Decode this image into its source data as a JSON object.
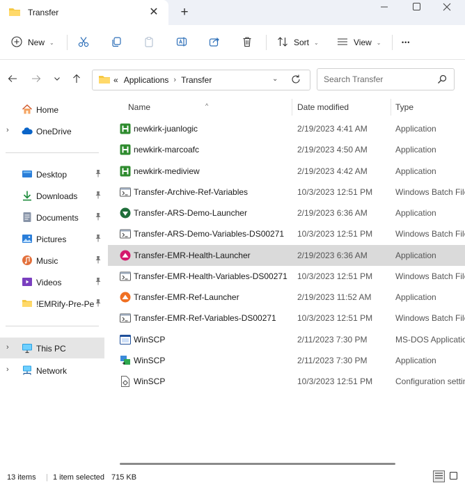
{
  "tab": {
    "title": "Transfer",
    "close_glyph": "✕",
    "new_tab_glyph": "+"
  },
  "window_controls": [
    "minimize-icon",
    "maximize-icon",
    "close-icon"
  ],
  "toolbar": {
    "new_label": "New",
    "sort_label": "Sort",
    "view_label": "View",
    "more_glyph": "•••",
    "dropdown_glyph": "⌄"
  },
  "address": {
    "overflow_glyph": "«",
    "separator_glyph": "›",
    "crumbs": [
      "Applications",
      "Transfer"
    ],
    "dropdown_glyph": "⌄"
  },
  "search": {
    "placeholder": "Search Transfer"
  },
  "sidebar": {
    "expand_glyph": "›",
    "items": [
      {
        "label": "Home",
        "icon": "home-icon"
      },
      {
        "label": "OneDrive",
        "icon": "cloud-icon"
      },
      {
        "label": "Desktop",
        "icon": "desktop-icon",
        "pinned": true
      },
      {
        "label": "Downloads",
        "icon": "download-icon",
        "pinned": true
      },
      {
        "label": "Documents",
        "icon": "document-icon",
        "pinned": true
      },
      {
        "label": "Pictures",
        "icon": "pictures-icon",
        "pinned": true
      },
      {
        "label": "Music",
        "icon": "music-icon",
        "pinned": true
      },
      {
        "label": "Videos",
        "icon": "videos-icon",
        "pinned": true
      },
      {
        "label": "!EMRify-Pre-Pen",
        "icon": "folder-icon",
        "pinned": true
      },
      {
        "label": "This PC",
        "icon": "this-pc-icon",
        "selected": true
      },
      {
        "label": "Network",
        "icon": "network-icon"
      }
    ]
  },
  "columns": {
    "name": "Name",
    "date": "Date modified",
    "type": "Type",
    "sort_glyph": "^"
  },
  "files": [
    {
      "name": "newkirk-juanlogic",
      "date": "2/19/2023 4:41 AM",
      "type": "Application",
      "icon": "h-app-icon"
    },
    {
      "name": "newkirk-marcoafc",
      "date": "2/19/2023 4:50 AM",
      "type": "Application",
      "icon": "h-app-icon"
    },
    {
      "name": "newkirk-mediview",
      "date": "2/19/2023 4:42 AM",
      "type": "Application",
      "icon": "h-app-icon"
    },
    {
      "name": "Transfer-Archive-Ref-Variables",
      "date": "10/3/2023 12:51 PM",
      "type": "Windows Batch File",
      "icon": "batch-file-icon"
    },
    {
      "name": "Transfer-ARS-Demo-Launcher",
      "date": "2/19/2023 6:36 AM",
      "type": "Application",
      "icon": "ars-launcher-icon"
    },
    {
      "name": "Transfer-ARS-Demo-Variables-DS00271",
      "date": "10/3/2023 12:51 PM",
      "type": "Windows Batch File",
      "icon": "batch-file-icon"
    },
    {
      "name": "Transfer-EMR-Health-Launcher",
      "date": "2/19/2023 6:36 AM",
      "type": "Application",
      "icon": "emr-health-launcher-icon",
      "selected": true
    },
    {
      "name": "Transfer-EMR-Health-Variables-DS00271",
      "date": "10/3/2023 12:51 PM",
      "type": "Windows Batch File",
      "icon": "batch-file-icon"
    },
    {
      "name": "Transfer-EMR-Ref-Launcher",
      "date": "2/19/2023 11:52 AM",
      "type": "Application",
      "icon": "emr-ref-launcher-icon"
    },
    {
      "name": "Transfer-EMR-Ref-Variables-DS00271",
      "date": "10/3/2023 12:51 PM",
      "type": "Windows Batch File",
      "icon": "batch-file-icon"
    },
    {
      "name": "WinSCP",
      "date": "2/11/2023 7:30 PM",
      "type": "MS-DOS Application",
      "icon": "msdos-app-icon"
    },
    {
      "name": "WinSCP",
      "date": "2/11/2023 7:30 PM",
      "type": "Application",
      "icon": "winscp-icon"
    },
    {
      "name": "WinSCP",
      "date": "10/3/2023 12:51 PM",
      "type": "Configuration settings",
      "icon": "config-file-icon"
    }
  ],
  "status": {
    "items": "13 items",
    "selected": "1 item selected",
    "size": "715 KB"
  },
  "colors": {
    "accent": "#0067c0",
    "folder": "#f5c842",
    "h_app": "#2e8b2e",
    "emr_health": "#d4186c",
    "emr_ref": "#f07023",
    "ars": "#1f6e3a",
    "selection": "#dadada"
  }
}
